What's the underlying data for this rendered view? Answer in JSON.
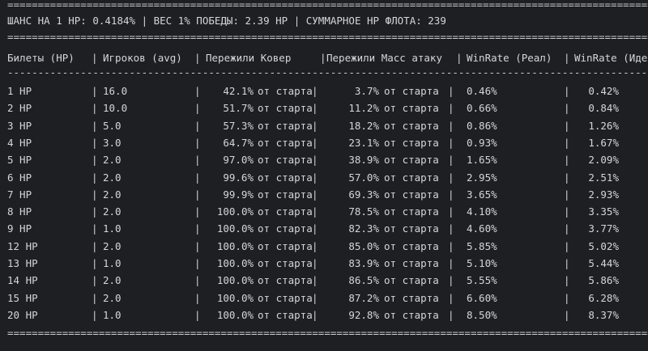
{
  "summary": "ШАНС НА 1 HP: 0.4184% | ВЕС 1% ПОБЕДЫ: 2.39 HP | СУММАРНОЕ HP ФЛОТА: 239",
  "separator_double": "==============================================================================================================",
  "separator_single": "--------------------------------------------------------------------------------------------------------------",
  "columns": [
    "Билеты (HP)",
    "Игроков (avg)",
    "Пережили Ковер",
    "Пережили Масс атаку",
    "WinRate (Реал)",
    "WinRate (Иде"
  ],
  "suffix": "от старта",
  "rows": [
    {
      "tickets": "1 HP",
      "players": "16.0",
      "carpet": "42.1%",
      "mass": "3.7%",
      "wr_real": "0.46%",
      "wr_ideal": "0.42%"
    },
    {
      "tickets": "2 HP",
      "players": "10.0",
      "carpet": "51.7%",
      "mass": "11.2%",
      "wr_real": "0.66%",
      "wr_ideal": "0.84%"
    },
    {
      "tickets": "3 HP",
      "players": "5.0",
      "carpet": "57.3%",
      "mass": "18.2%",
      "wr_real": "0.86%",
      "wr_ideal": "1.26%"
    },
    {
      "tickets": "4 HP",
      "players": "3.0",
      "carpet": "64.7%",
      "mass": "23.1%",
      "wr_real": "0.93%",
      "wr_ideal": "1.67%"
    },
    {
      "tickets": "5 HP",
      "players": "2.0",
      "carpet": "97.0%",
      "mass": "38.9%",
      "wr_real": "1.65%",
      "wr_ideal": "2.09%"
    },
    {
      "tickets": "6 HP",
      "players": "2.0",
      "carpet": "99.6%",
      "mass": "57.0%",
      "wr_real": "2.95%",
      "wr_ideal": "2.51%"
    },
    {
      "tickets": "7 HP",
      "players": "2.0",
      "carpet": "99.9%",
      "mass": "69.3%",
      "wr_real": "3.65%",
      "wr_ideal": "2.93%"
    },
    {
      "tickets": "8 HP",
      "players": "2.0",
      "carpet": "100.0%",
      "mass": "78.5%",
      "wr_real": "4.10%",
      "wr_ideal": "3.35%"
    },
    {
      "tickets": "9 HP",
      "players": "1.0",
      "carpet": "100.0%",
      "mass": "82.3%",
      "wr_real": "4.60%",
      "wr_ideal": "3.77%"
    },
    {
      "tickets": "12 HP",
      "players": "2.0",
      "carpet": "100.0%",
      "mass": "85.0%",
      "wr_real": "5.85%",
      "wr_ideal": "5.02%"
    },
    {
      "tickets": "13 HP",
      "players": "1.0",
      "carpet": "100.0%",
      "mass": "83.9%",
      "wr_real": "5.10%",
      "wr_ideal": "5.44%"
    },
    {
      "tickets": "14 HP",
      "players": "2.0",
      "carpet": "100.0%",
      "mass": "86.5%",
      "wr_real": "5.55%",
      "wr_ideal": "5.86%"
    },
    {
      "tickets": "15 HP",
      "players": "2.0",
      "carpet": "100.0%",
      "mass": "87.2%",
      "wr_real": "6.60%",
      "wr_ideal": "6.28%"
    },
    {
      "tickets": "20 HP",
      "players": "1.0",
      "carpet": "100.0%",
      "mass": "92.8%",
      "wr_real": "8.50%",
      "wr_ideal": "8.37%"
    }
  ]
}
